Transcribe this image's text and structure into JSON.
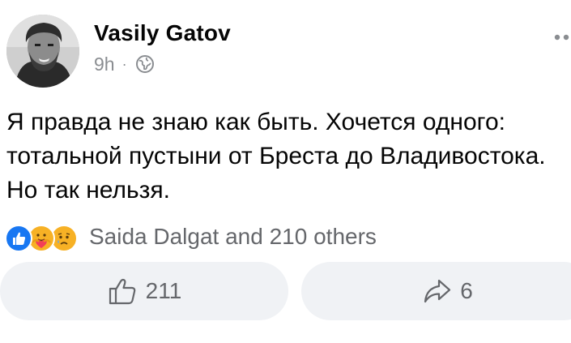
{
  "post": {
    "author": "Vasily Gatov",
    "time": "9h",
    "separator": "·",
    "privacy_icon": "globe-icon",
    "text": "Я правда не знаю как быть. Хочется одного: тотальной пустыни от Бреста до Владивостока. Но так нельзя."
  },
  "reactions": {
    "icons": [
      "like-reaction-icon",
      "care-reaction-icon",
      "sad-reaction-icon"
    ],
    "summary": "Saida Dalgat and 210 others"
  },
  "actions": {
    "like_count": "211",
    "share_count": "6"
  },
  "colors": {
    "like_blue": "#1877f2",
    "secondary_text": "#65676b",
    "button_bg": "#f0f2f5",
    "reaction_yellow": "#f7b125"
  }
}
